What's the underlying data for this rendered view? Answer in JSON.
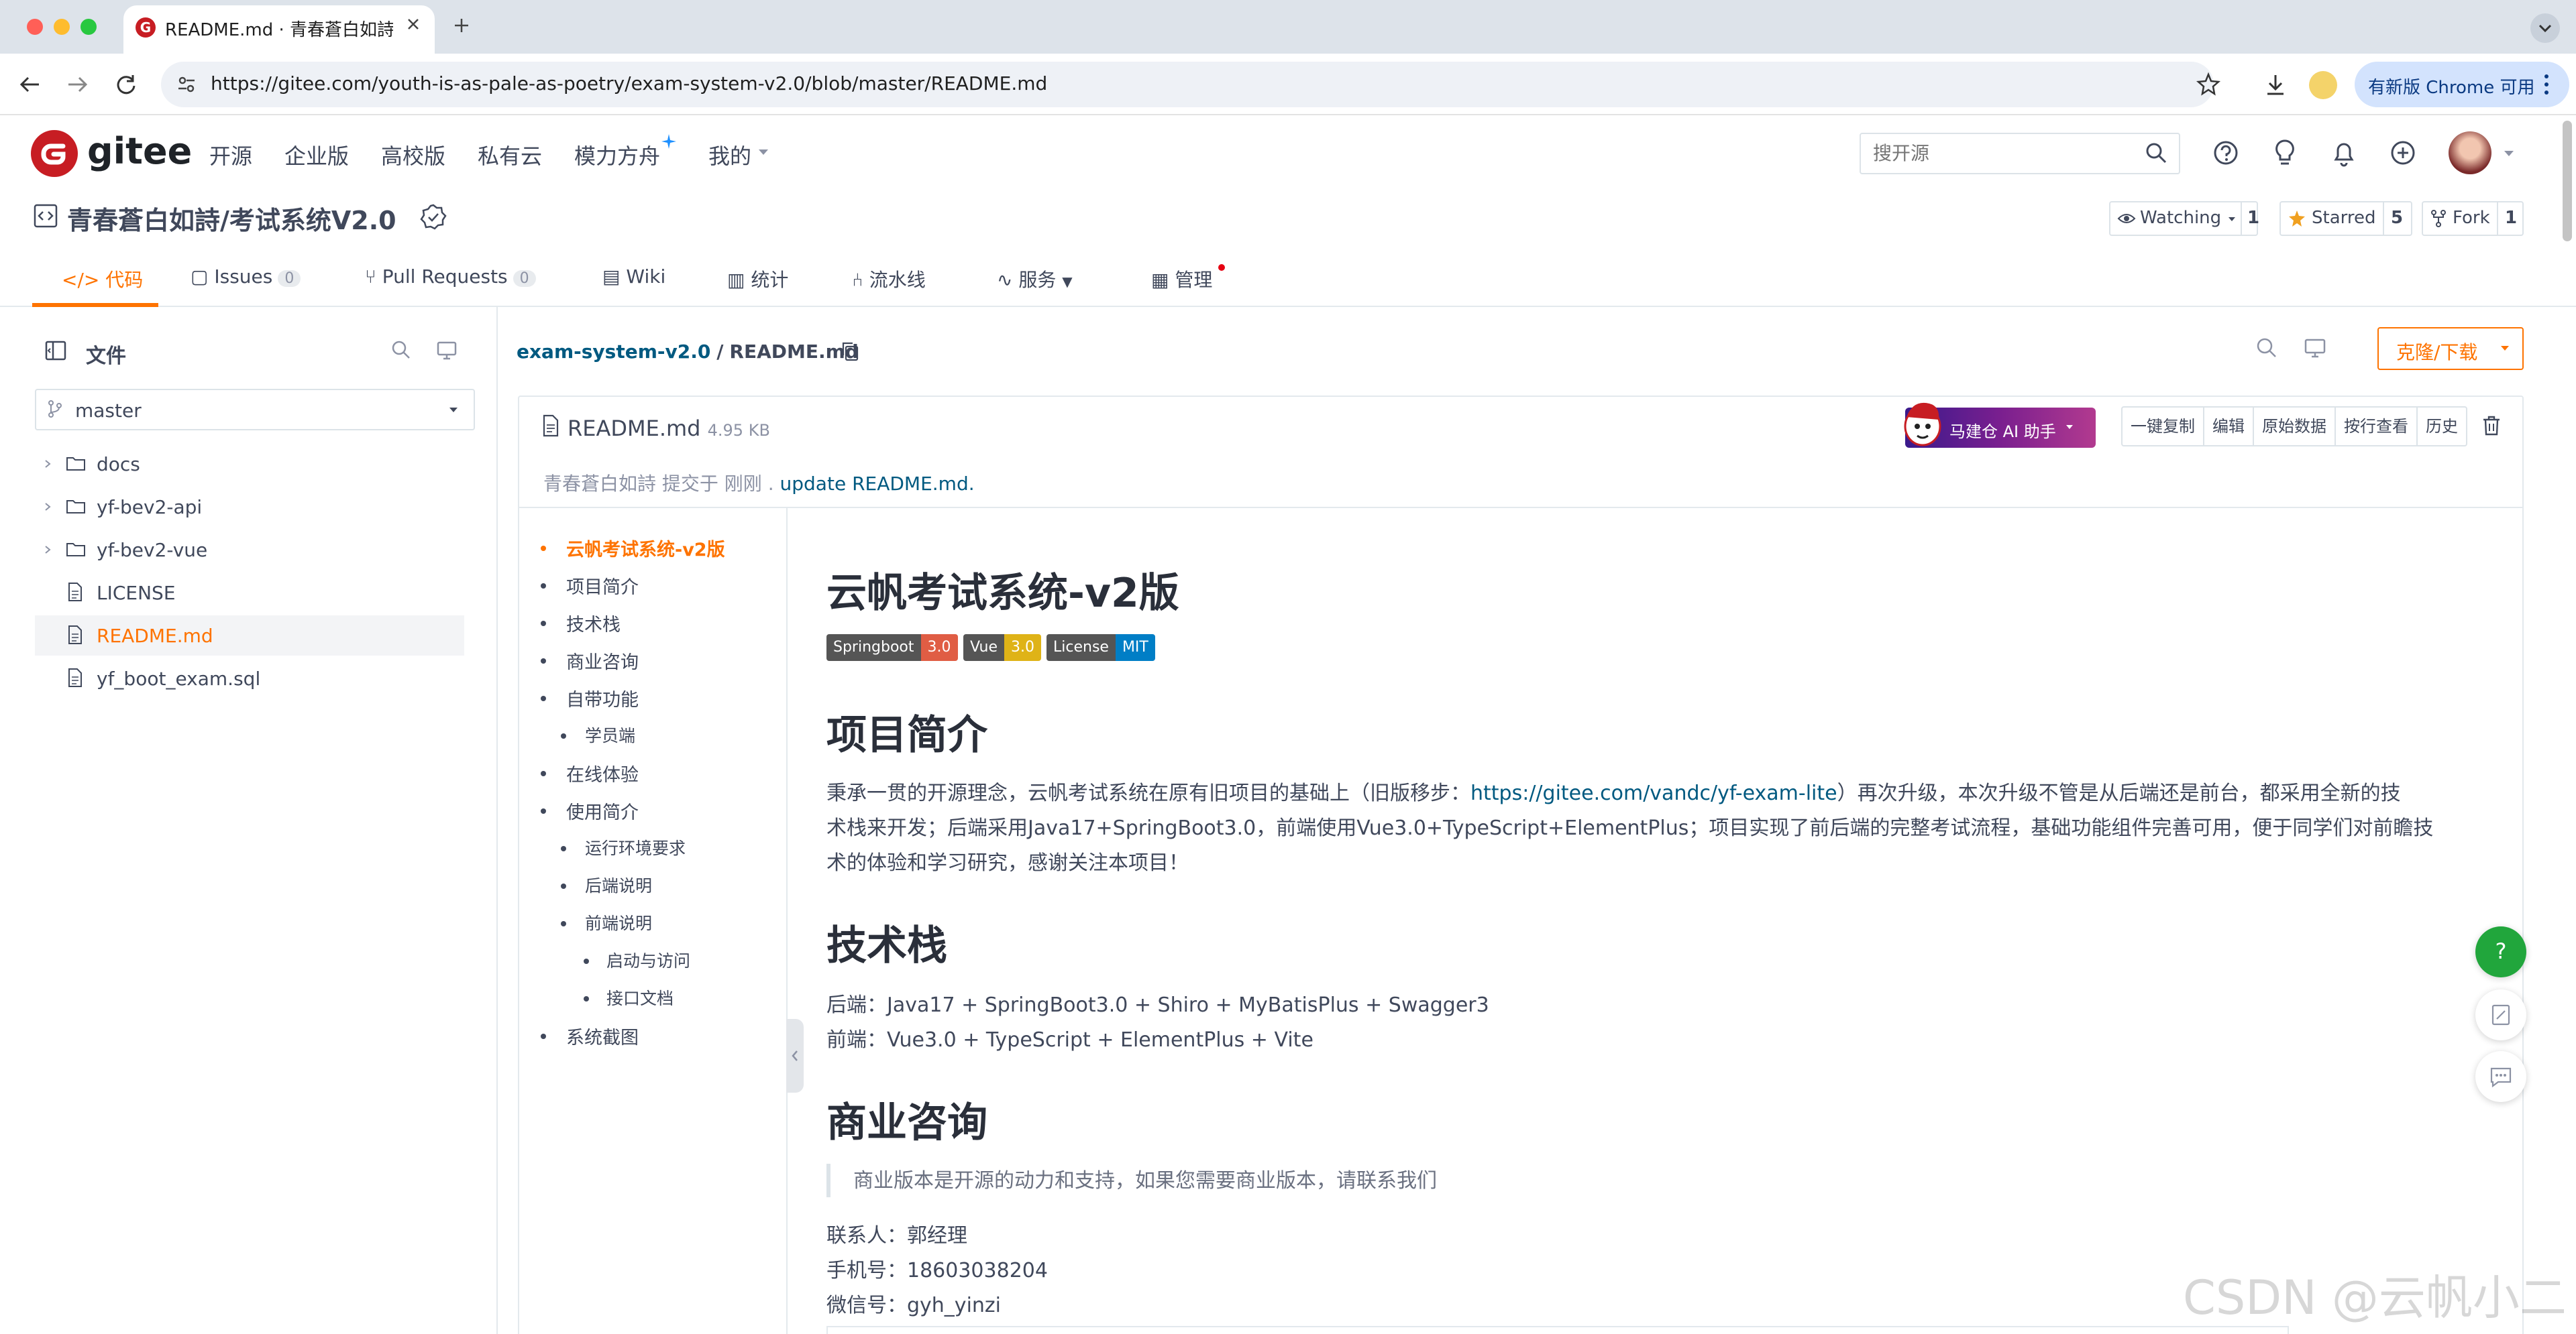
{
  "browser": {
    "tab_title": "README.md · 青春蒼白如詩/考",
    "url": "https://gitee.com/youth-is-as-pale-as-poetry/exam-system-v2.0/blob/master/README.md",
    "update_label": "有新版 Chrome 可用"
  },
  "header": {
    "logo_text": "gitee",
    "nav": [
      "开源",
      "企业版",
      "高校版",
      "私有云",
      "模力方舟",
      "我的"
    ],
    "search_placeholder": "搜开源"
  },
  "repo": {
    "title": "青春蒼白如詩/考试系统V2.0",
    "watching_label": "Watching",
    "watching_count": "1",
    "starred_label": "Starred",
    "starred_count": "5",
    "fork_label": "Fork",
    "fork_count": "1"
  },
  "tabs": {
    "code": "代码",
    "issues": "Issues",
    "issues_count": "0",
    "pr": "Pull Requests",
    "pr_count": "0",
    "wiki": "Wiki",
    "stats": "统计",
    "pipeline": "流水线",
    "service": "服务",
    "manage": "管理"
  },
  "sidebar": {
    "title": "文件",
    "branch": "master",
    "items": [
      {
        "label": "docs",
        "type": "folder"
      },
      {
        "label": "yf-bev2-api",
        "type": "folder"
      },
      {
        "label": "yf-bev2-vue",
        "type": "folder"
      },
      {
        "label": "LICENSE",
        "type": "file"
      },
      {
        "label": "README.md",
        "type": "file"
      },
      {
        "label": "yf_boot_exam.sql",
        "type": "file"
      }
    ]
  },
  "main": {
    "breadcrumb_repo": "exam-system-v2.0",
    "breadcrumb_sep": "/",
    "breadcrumb_file": "README.md",
    "clone_label": "克隆/下载",
    "file_name": "README.md",
    "file_size": "4.95 KB",
    "commit_author": "青春蒼白如詩 提交于 刚刚 .",
    "commit_message": "update README.md.",
    "ai_label": "马建仓 AI 助手",
    "buttons": [
      "一键复制",
      "编辑",
      "原始数据",
      "按行查看",
      "历史"
    ]
  },
  "toc": [
    {
      "label": "云帆考试系统-v2版",
      "level": 1,
      "active": true
    },
    {
      "label": "项目简介",
      "level": 1
    },
    {
      "label": "技术栈",
      "level": 1
    },
    {
      "label": "商业咨询",
      "level": 1
    },
    {
      "label": "自带功能",
      "level": 1
    },
    {
      "label": "学员端",
      "level": 2
    },
    {
      "label": "在线体验",
      "level": 1
    },
    {
      "label": "使用简介",
      "level": 1
    },
    {
      "label": "运行环境要求",
      "level": 2
    },
    {
      "label": "后端说明",
      "level": 2
    },
    {
      "label": "前端说明",
      "level": 2
    },
    {
      "label": "启动与访问",
      "level": 3
    },
    {
      "label": "接口文档",
      "level": 3
    },
    {
      "label": "系统截图",
      "level": 1
    }
  ],
  "readme": {
    "h1": "云帆考试系统-v2版",
    "badges": [
      {
        "left": "Springboot",
        "right": "3.0",
        "color": "#e05d44"
      },
      {
        "left": "Vue",
        "right": "3.0",
        "color": "#dfb317"
      },
      {
        "left": "License",
        "right": "MIT",
        "color": "#007ec6"
      }
    ],
    "intro_heading": "项目简介",
    "intro_line1_a": "秉承一贯的开源理念，云帆考试系统在原有旧项目的基础上（旧版移步：",
    "intro_link": "https://gitee.com/vandc/yf-exam-lite",
    "intro_line1_b": "）再次升级，本次升级不管是从后端还是前台，都采用全新的技",
    "intro_line2": "术栈来开发；后端采用Java17+SpringBoot3.0，前端使用Vue3.0+TypeScript+ElementPlus；项目实现了前后端的完整考试流程，基础功能组件完善可用，便于同学们对前瞻技",
    "intro_line3": "术的体验和学习研究，感谢关注本项目！",
    "stack_heading": "技术栈",
    "stack_backend": "后端：Java17 + SpringBoot3.0 + Shiro + MyBatisPlus + Swagger3",
    "stack_frontend": "前端：Vue3.0 + TypeScript + ElementPlus + Vite",
    "biz_heading": "商业咨询",
    "biz_quote": "商业版本是开源的动力和支持，如果您需要商业版本，请联系我们",
    "contact": "联系人：郭经理",
    "phone": "手机号：18603038204",
    "wechat": "微信号：gyh_yinzi"
  },
  "watermark": "CSDN @云帆小二",
  "colors": {
    "accent": "#fe7300",
    "brand": "#c71d23",
    "link": "#005980"
  }
}
